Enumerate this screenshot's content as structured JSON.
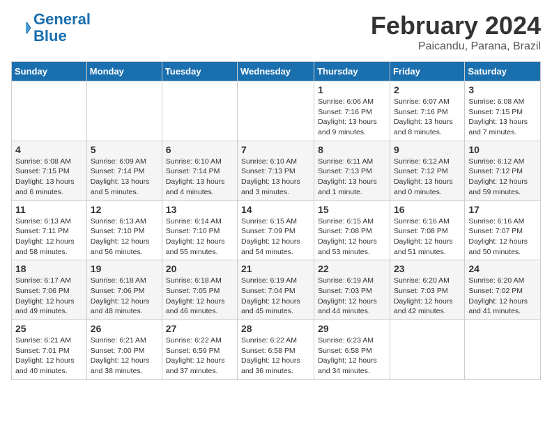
{
  "header": {
    "logo_line1": "General",
    "logo_line2": "Blue",
    "title": "February 2024",
    "location": "Paicandu, Parana, Brazil"
  },
  "days_of_week": [
    "Sunday",
    "Monday",
    "Tuesday",
    "Wednesday",
    "Thursday",
    "Friday",
    "Saturday"
  ],
  "weeks": [
    [
      {
        "day": "",
        "info": ""
      },
      {
        "day": "",
        "info": ""
      },
      {
        "day": "",
        "info": ""
      },
      {
        "day": "",
        "info": ""
      },
      {
        "day": "1",
        "info": "Sunrise: 6:06 AM\nSunset: 7:16 PM\nDaylight: 13 hours\nand 9 minutes."
      },
      {
        "day": "2",
        "info": "Sunrise: 6:07 AM\nSunset: 7:16 PM\nDaylight: 13 hours\nand 8 minutes."
      },
      {
        "day": "3",
        "info": "Sunrise: 6:08 AM\nSunset: 7:15 PM\nDaylight: 13 hours\nand 7 minutes."
      }
    ],
    [
      {
        "day": "4",
        "info": "Sunrise: 6:08 AM\nSunset: 7:15 PM\nDaylight: 13 hours\nand 6 minutes."
      },
      {
        "day": "5",
        "info": "Sunrise: 6:09 AM\nSunset: 7:14 PM\nDaylight: 13 hours\nand 5 minutes."
      },
      {
        "day": "6",
        "info": "Sunrise: 6:10 AM\nSunset: 7:14 PM\nDaylight: 13 hours\nand 4 minutes."
      },
      {
        "day": "7",
        "info": "Sunrise: 6:10 AM\nSunset: 7:13 PM\nDaylight: 13 hours\nand 3 minutes."
      },
      {
        "day": "8",
        "info": "Sunrise: 6:11 AM\nSunset: 7:13 PM\nDaylight: 13 hours\nand 1 minute."
      },
      {
        "day": "9",
        "info": "Sunrise: 6:12 AM\nSunset: 7:12 PM\nDaylight: 13 hours\nand 0 minutes."
      },
      {
        "day": "10",
        "info": "Sunrise: 6:12 AM\nSunset: 7:12 PM\nDaylight: 12 hours\nand 59 minutes."
      }
    ],
    [
      {
        "day": "11",
        "info": "Sunrise: 6:13 AM\nSunset: 7:11 PM\nDaylight: 12 hours\nand 58 minutes."
      },
      {
        "day": "12",
        "info": "Sunrise: 6:13 AM\nSunset: 7:10 PM\nDaylight: 12 hours\nand 56 minutes."
      },
      {
        "day": "13",
        "info": "Sunrise: 6:14 AM\nSunset: 7:10 PM\nDaylight: 12 hours\nand 55 minutes."
      },
      {
        "day": "14",
        "info": "Sunrise: 6:15 AM\nSunset: 7:09 PM\nDaylight: 12 hours\nand 54 minutes."
      },
      {
        "day": "15",
        "info": "Sunrise: 6:15 AM\nSunset: 7:08 PM\nDaylight: 12 hours\nand 53 minutes."
      },
      {
        "day": "16",
        "info": "Sunrise: 6:16 AM\nSunset: 7:08 PM\nDaylight: 12 hours\nand 51 minutes."
      },
      {
        "day": "17",
        "info": "Sunrise: 6:16 AM\nSunset: 7:07 PM\nDaylight: 12 hours\nand 50 minutes."
      }
    ],
    [
      {
        "day": "18",
        "info": "Sunrise: 6:17 AM\nSunset: 7:06 PM\nDaylight: 12 hours\nand 49 minutes."
      },
      {
        "day": "19",
        "info": "Sunrise: 6:18 AM\nSunset: 7:06 PM\nDaylight: 12 hours\nand 48 minutes."
      },
      {
        "day": "20",
        "info": "Sunrise: 6:18 AM\nSunset: 7:05 PM\nDaylight: 12 hours\nand 46 minutes."
      },
      {
        "day": "21",
        "info": "Sunrise: 6:19 AM\nSunset: 7:04 PM\nDaylight: 12 hours\nand 45 minutes."
      },
      {
        "day": "22",
        "info": "Sunrise: 6:19 AM\nSunset: 7:03 PM\nDaylight: 12 hours\nand 44 minutes."
      },
      {
        "day": "23",
        "info": "Sunrise: 6:20 AM\nSunset: 7:03 PM\nDaylight: 12 hours\nand 42 minutes."
      },
      {
        "day": "24",
        "info": "Sunrise: 6:20 AM\nSunset: 7:02 PM\nDaylight: 12 hours\nand 41 minutes."
      }
    ],
    [
      {
        "day": "25",
        "info": "Sunrise: 6:21 AM\nSunset: 7:01 PM\nDaylight: 12 hours\nand 40 minutes."
      },
      {
        "day": "26",
        "info": "Sunrise: 6:21 AM\nSunset: 7:00 PM\nDaylight: 12 hours\nand 38 minutes."
      },
      {
        "day": "27",
        "info": "Sunrise: 6:22 AM\nSunset: 6:59 PM\nDaylight: 12 hours\nand 37 minutes."
      },
      {
        "day": "28",
        "info": "Sunrise: 6:22 AM\nSunset: 6:58 PM\nDaylight: 12 hours\nand 36 minutes."
      },
      {
        "day": "29",
        "info": "Sunrise: 6:23 AM\nSunset: 6:58 PM\nDaylight: 12 hours\nand 34 minutes."
      },
      {
        "day": "",
        "info": ""
      },
      {
        "day": "",
        "info": ""
      }
    ]
  ]
}
